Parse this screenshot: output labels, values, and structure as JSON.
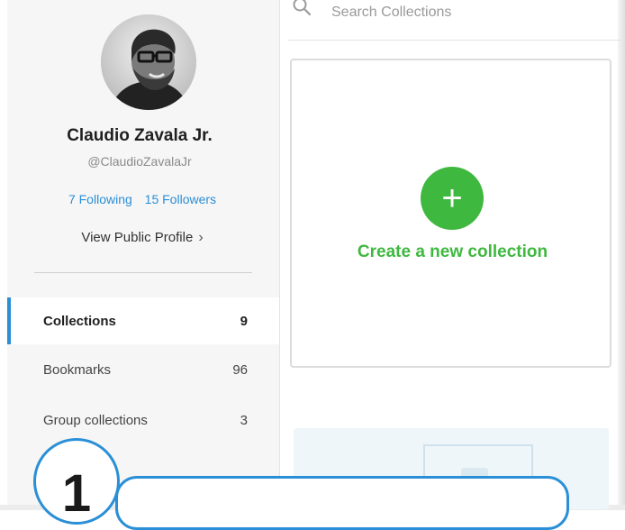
{
  "profile": {
    "name": "Claudio Zavala Jr.",
    "handle": "@ClaudioZavalaJr",
    "following": "7 Following",
    "followers": "15 Followers",
    "view_profile": "View Public Profile",
    "view_profile_chevron": "›"
  },
  "nav": {
    "items": [
      {
        "label": "Collections",
        "count": "9"
      },
      {
        "label": "Bookmarks",
        "count": "96"
      },
      {
        "label": "Group collections",
        "count": "3"
      }
    ]
  },
  "search": {
    "placeholder": "Search Collections"
  },
  "create": {
    "plus": "+",
    "label": "Create a new collection"
  },
  "callout": {
    "step": "1"
  },
  "colors": {
    "accent_blue": "#2a8fd6",
    "accent_green": "#3fb83f",
    "sidebar_bg": "#f6f6f6"
  },
  "icons": {
    "search": "search-icon",
    "chevron": "chevron-right-icon"
  }
}
